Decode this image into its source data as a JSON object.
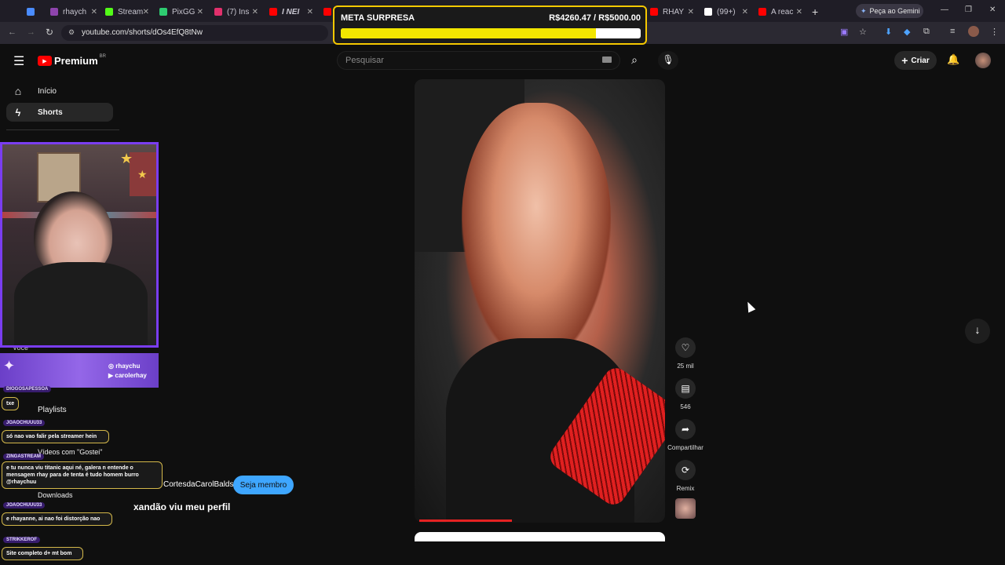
{
  "browser": {
    "tabs": [
      {
        "label": "",
        "color": "#4a8cff"
      },
      {
        "label": "rhaych",
        "color": "#8e44ad"
      },
      {
        "label": "Stream",
        "color": "#53fc18"
      },
      {
        "label": "PixGG",
        "color": "#2ecc71"
      },
      {
        "label": "(7) Ins",
        "color": "#e1306c"
      },
      {
        "label": "I NEI",
        "color": "#ff0000"
      },
      {
        "label": "RHAY",
        "color": "#ff0000"
      },
      {
        "label": "(99+)",
        "color": "#ffffff"
      },
      {
        "label": "A reac",
        "color": "#ff0000"
      }
    ],
    "new_tab": "+",
    "gemini_label": "Peça ao Gemini",
    "url": "youtube.com/shorts/dOs4EfQ8tNw"
  },
  "meta": {
    "title": "META SURPRESA",
    "amount": "R$4260.47 / R$5000.00",
    "progress": 0.852
  },
  "youtube": {
    "brand": "Premium",
    "brand_region": "BR",
    "search_placeholder": "Pesquisar",
    "create_label": "Criar",
    "sidebar": [
      {
        "label": "Início",
        "icon": "home-icon"
      },
      {
        "label": "Shorts",
        "icon": "shorts-icon"
      }
    ],
    "sidebar_partial": [
      {
        "label": "Você"
      },
      {
        "label": "Playlists"
      },
      {
        "label": "Vídeos com \"Gostei\""
      },
      {
        "label": "Downloads"
      }
    ]
  },
  "stream_overlay": {
    "socials": [
      "rhaychu",
      "carolerhay"
    ]
  },
  "chat": [
    {
      "name": "DIOGOSAPESSOA",
      "message": "txe"
    },
    {
      "name": "JOAOCHUUU33",
      "message": "só nao vao falir pela streamer hein"
    },
    {
      "name": "ZINGASTREAM",
      "message": "e tu nunca viu titanic aqui né, galera n entende o mensagem rhay para de tenta é tudo homem burro @rhaychuu"
    },
    {
      "name": "JOAOCHUUU33",
      "message": "e rhayanne, ai nao foi distorção nao"
    },
    {
      "name": "STRIKKEROF",
      "message": "Site completo d+ mt bom"
    }
  ],
  "short": {
    "channel": "CortesdaCarolBalds",
    "member_button": "Seja membro",
    "title": "xandão viu meu perfil",
    "likes": "25 mil",
    "comments": "546",
    "share_label": "Compartilhar",
    "remix_label": "Remix",
    "progress": 0.37
  }
}
